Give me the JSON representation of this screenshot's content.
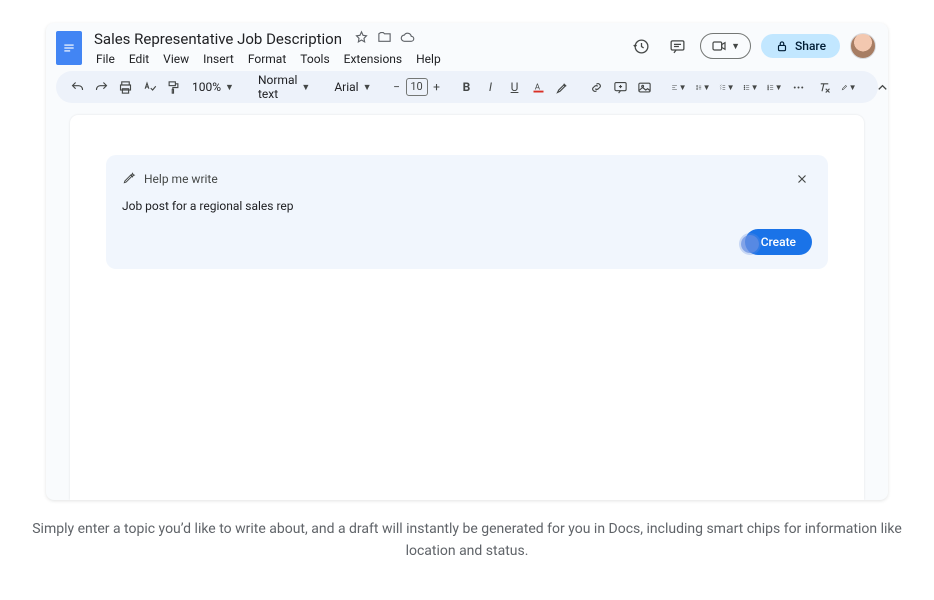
{
  "header": {
    "doc_title": "Sales Representative Job Description",
    "menu": [
      "File",
      "Edit",
      "View",
      "Insert",
      "Format",
      "Tools",
      "Extensions",
      "Help"
    ],
    "share_label": "Share"
  },
  "toolbar": {
    "zoom_label": "100%",
    "style_label": "Normal text",
    "font_label": "Arial",
    "font_size": "10"
  },
  "hmw": {
    "title": "Help me write",
    "prompt_value": "Job post for a regional sales rep",
    "create_label": "Create"
  },
  "caption": "Simply enter a topic you’d like to write about, and a draft will instantly be generated for you in Docs, including smart chips for information like location and status."
}
